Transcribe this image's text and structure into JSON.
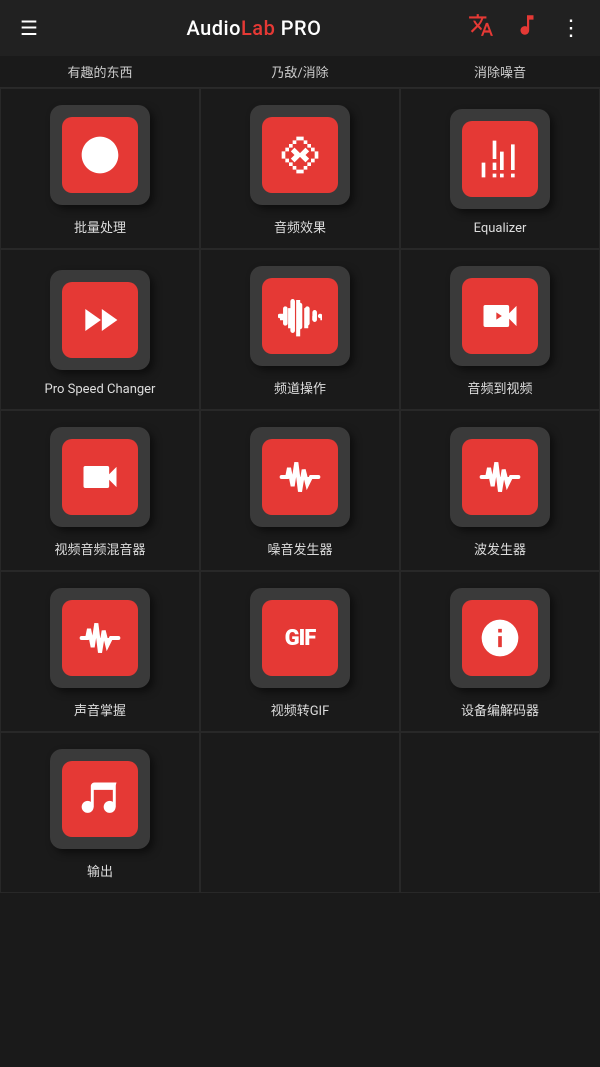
{
  "header": {
    "menu_label": "☰",
    "title_audio": "Audio",
    "title_lab": "Lab ",
    "title_pro": "PRO",
    "translate_icon": "🔤",
    "music_icon": "♪",
    "more_icon": "⋮"
  },
  "top_partial": {
    "items": [
      "有趣的东西",
      "乃敌/消除",
      "消除噪音"
    ]
  },
  "grid": {
    "items": [
      {
        "id": "batch",
        "label": "批量处理",
        "icon": "music-add"
      },
      {
        "id": "effects",
        "label": "音频效果",
        "icon": "music-x"
      },
      {
        "id": "equalizer",
        "label": "Equalizer",
        "icon": "equalizer"
      },
      {
        "id": "speed",
        "label": "Pro Speed Changer",
        "icon": "fast-forward"
      },
      {
        "id": "channel",
        "label": "频道操作",
        "icon": "waveform"
      },
      {
        "id": "audio-video",
        "label": "音频到视频",
        "icon": "video-camera"
      },
      {
        "id": "video-audio-mixer",
        "label": "视频音频混音器",
        "icon": "video-music"
      },
      {
        "id": "noise-gen",
        "label": "噪音发生器",
        "icon": "waveform2"
      },
      {
        "id": "wave-gen",
        "label": "波发生器",
        "icon": "waveform3"
      },
      {
        "id": "sound-grab",
        "label": "声音掌握",
        "icon": "waveform4"
      },
      {
        "id": "video-gif",
        "label": "视频转GIF",
        "icon": "gif"
      },
      {
        "id": "decoder",
        "label": "设备编解码器",
        "icon": "info"
      },
      {
        "id": "output",
        "label": "输出",
        "icon": "music-output"
      }
    ]
  }
}
